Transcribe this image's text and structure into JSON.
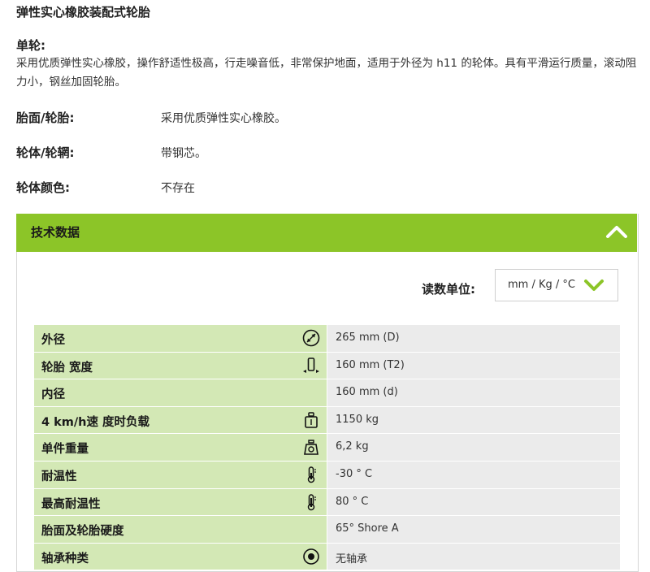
{
  "page": {
    "title": "弹性实心橡胶装配式轮胎",
    "subtitle": "单轮:",
    "description": "采用优质弹性实心橡胶，操作舒适性极高，行走噪音低，非常保护地面，适用于外径为 h11 的轮体。具有平滑运行质量，滚动阻力小，钢丝加固轮胎。"
  },
  "attributes": [
    {
      "label": "胎面/轮胎:",
      "value": "采用优质弹性实心橡胶。"
    },
    {
      "label": "轮体/轮辋:",
      "value": "带钢芯。"
    },
    {
      "label": "轮体颜色:",
      "value": "不存在"
    }
  ],
  "tech": {
    "title": "技术数据",
    "units_label": "读数单位:",
    "units_value": "mm / Kg / °C",
    "accent_color": "#8cc528",
    "rows": [
      {
        "label": "外径",
        "value": "265 mm (D)",
        "icon": "outer-diameter-icon"
      },
      {
        "label": "轮胎 宽度",
        "value": "160 mm (T2)",
        "icon": "tire-width-icon"
      },
      {
        "label": "内径",
        "value": "160 mm (d)",
        "icon": ""
      },
      {
        "label": "4 km/h速 度时负载",
        "value": "1150 kg",
        "icon": "load-weight-icon"
      },
      {
        "label": "单件重量",
        "value": "6,2 kg",
        "icon": "unit-weight-icon"
      },
      {
        "label": "耐温性",
        "value": "-30 ° C",
        "icon": "thermometer-icon"
      },
      {
        "label": "最高耐温性",
        "value": "80 ° C",
        "icon": "thermometer-icon"
      },
      {
        "label": "胎面及轮胎硬度",
        "value": "65° Shore A",
        "icon": ""
      },
      {
        "label": "轴承种类",
        "value": "无轴承",
        "icon": "bearing-type-icon"
      }
    ]
  }
}
